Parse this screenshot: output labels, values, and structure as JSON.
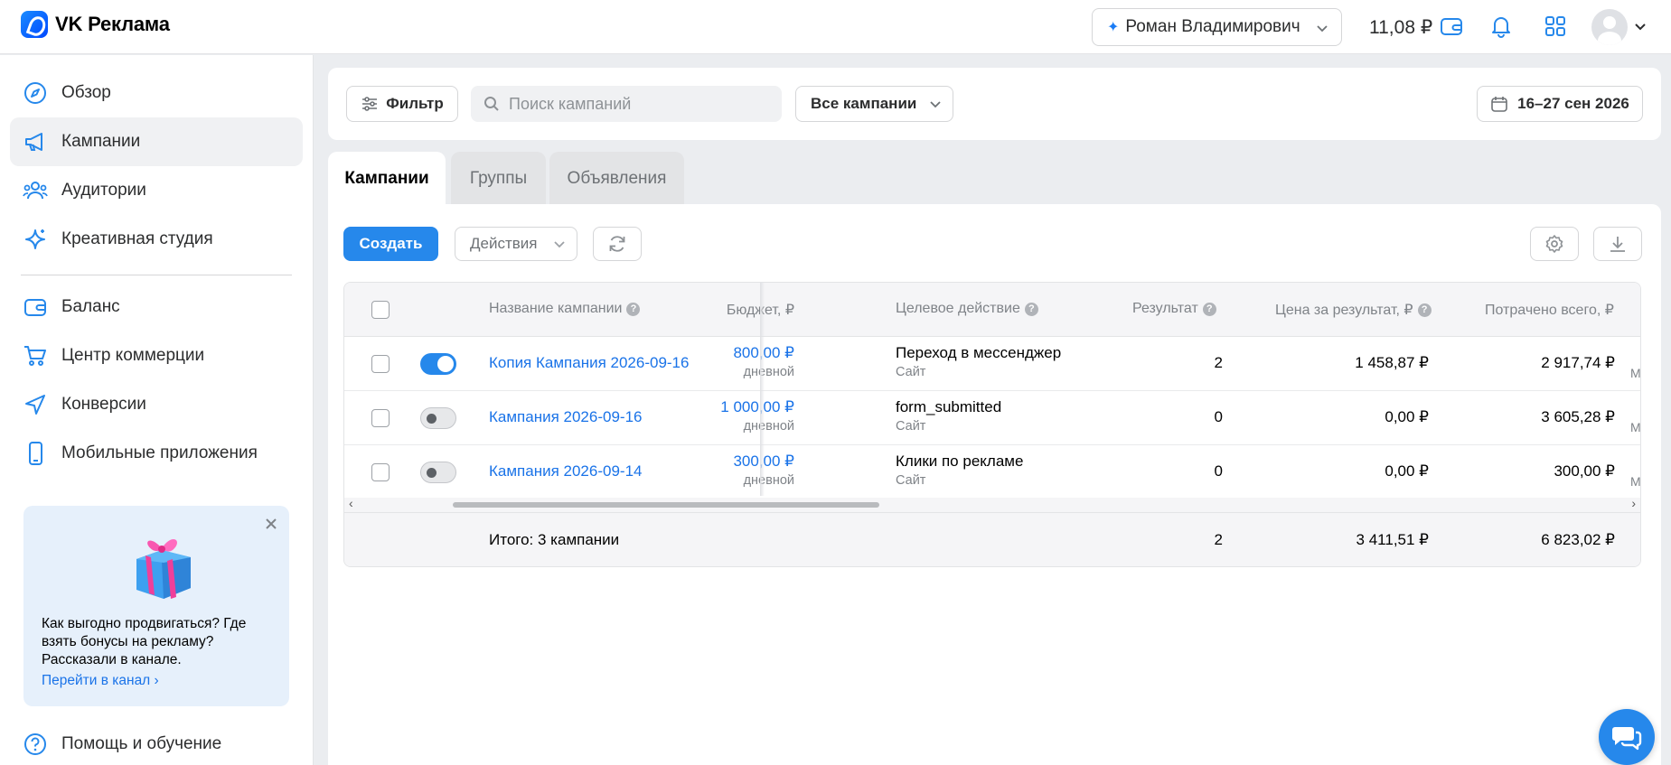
{
  "header": {
    "logo_text": "VK Реклама",
    "account_name": "Роман Владимирович",
    "balance": "11,08 ₽"
  },
  "sidebar": {
    "items": [
      {
        "label": "Обзор",
        "icon": "compass-icon"
      },
      {
        "label": "Кампании",
        "icon": "megaphone-icon",
        "active": true
      },
      {
        "label": "Аудитории",
        "icon": "users-icon"
      },
      {
        "label": "Креативная студия",
        "icon": "sparkle-icon"
      },
      {
        "label": "Баланс",
        "icon": "wallet-icon"
      },
      {
        "label": "Центр коммерции",
        "icon": "cart-icon"
      },
      {
        "label": "Конверсии",
        "icon": "send-icon"
      },
      {
        "label": "Мобильные приложения",
        "icon": "phone-icon"
      },
      {
        "label": "Помощь и обучение",
        "icon": "question-icon"
      }
    ],
    "promo": {
      "text": "Как выгодно продвигаться? Где взять бонусы на рекламу? Рассказали в канале.",
      "link": "Перейти в канал"
    }
  },
  "filterbar": {
    "filter_label": "Фильтр",
    "search_placeholder": "Поиск кампаний",
    "campaigns_select": "Все кампании",
    "date_range": "16–27 сен 2026"
  },
  "tabs": [
    "Кампании",
    "Группы",
    "Объявления"
  ],
  "toolbar": {
    "create_label": "Создать",
    "actions_label": "Действия"
  },
  "table": {
    "columns": {
      "name": "Название кампании",
      "budget": "Бюджет, ₽",
      "goal": "Целевое действие",
      "result": "Результат",
      "cpr": "Цена за результат, ₽",
      "spent": "Потрачено всего, ₽"
    },
    "rows": [
      {
        "enabled": true,
        "name": "Копия Кампания 2026-09-16",
        "budget": "800,00 ₽",
        "budget_type": "дневной",
        "goal": "Переход в мессенджер",
        "goal_sub": "Сайт",
        "result": "2",
        "cpr": "1 458,87 ₽",
        "spent": "2 917,74 ₽",
        "cut": "М"
      },
      {
        "enabled": false,
        "name": "Кампания 2026-09-16",
        "budget": "1 000,00 ₽",
        "budget_type": "дневной",
        "goal": "form_submitted",
        "goal_sub": "Сайт",
        "result": "0",
        "cpr": "0,00 ₽",
        "spent": "3 605,28 ₽",
        "cut": "М"
      },
      {
        "enabled": false,
        "name": "Кампания 2026-09-14",
        "budget": "300,00 ₽",
        "budget_type": "дневной",
        "goal": "Клики по рекламе",
        "goal_sub": "Сайт",
        "result": "0",
        "cpr": "0,00 ₽",
        "spent": "300,00 ₽",
        "cut": "М"
      }
    ],
    "total": {
      "label": "Итого: 3 кампании",
      "result": "2",
      "cpr": "3 411,51 ₽",
      "spent": "6 823,02 ₽"
    }
  },
  "colors": {
    "accent": "#2688eb",
    "link": "#1a73e8"
  }
}
